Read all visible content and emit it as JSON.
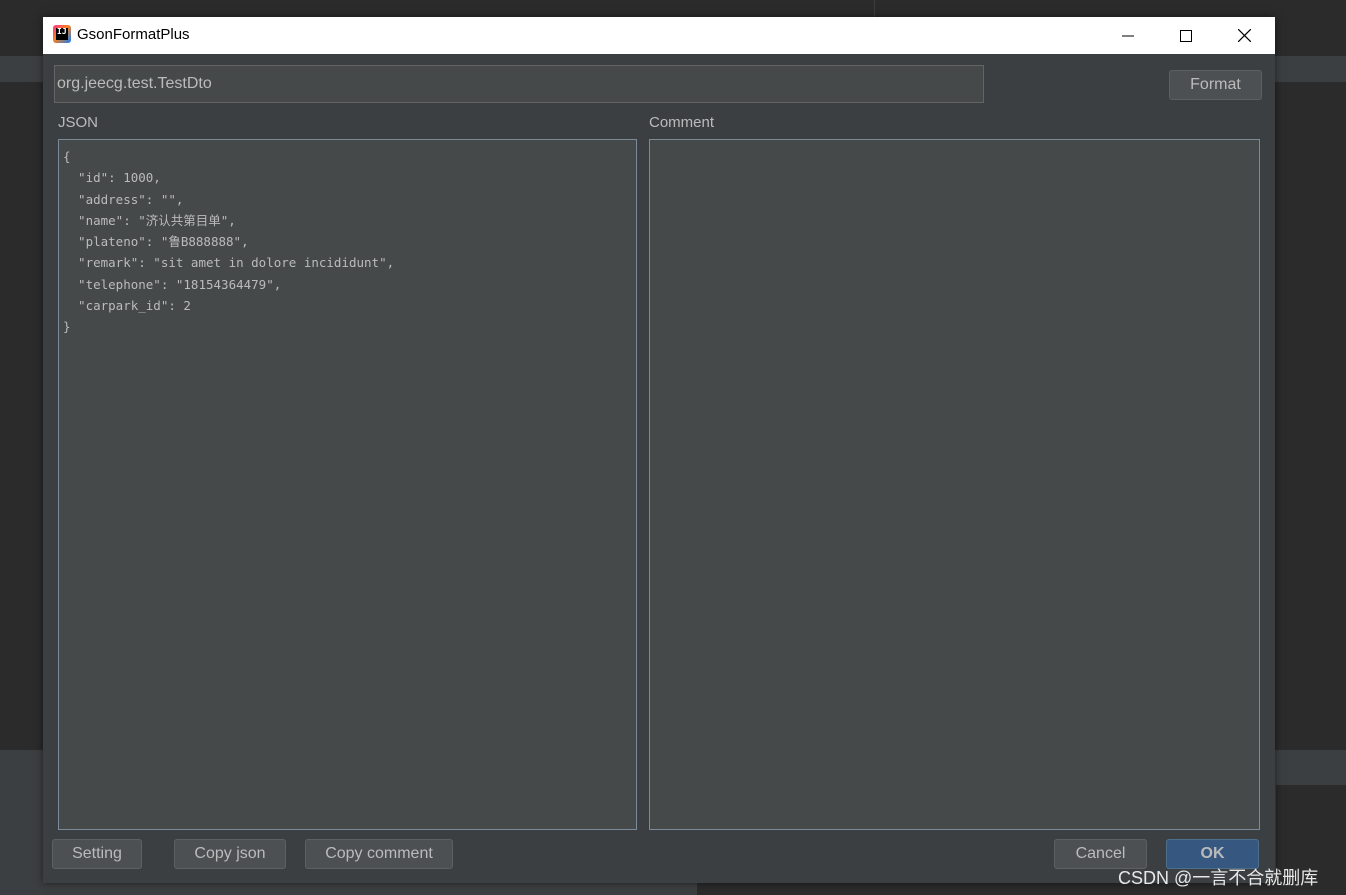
{
  "dialog": {
    "title": "GsonFormatPlus",
    "icon": "intellij-app-icon",
    "icon_mark": "IJ",
    "window_controls": [
      "minimize-icon",
      "maximize-icon",
      "close-icon"
    ]
  },
  "class_input": {
    "value": "org.jeecg.test.TestDto"
  },
  "toolbar": {
    "format_label": "Format"
  },
  "json_pane": {
    "label": "JSON",
    "lines": [
      "{",
      "  \"id\": 1000,",
      "  \"address\": \"\",",
      "  \"name\": \"济认共第目单\",",
      "  \"plateno\": \"鲁B888888\",",
      "  \"remark\": \"sit amet in dolore incididunt\",",
      "  \"telephone\": \"18154364479\",",
      "  \"carpark_id\": 2",
      "}"
    ]
  },
  "comment_pane": {
    "label": "Comment",
    "value": ""
  },
  "footer": {
    "setting_label": "Setting",
    "copy_json_label": "Copy  json",
    "copy_comment_label": "Copy comment",
    "cancel_label": "Cancel",
    "ok_label": "OK"
  },
  "watermark": "CSDN @一言不合就删库",
  "colors": {
    "dialog_bg": "#3c3f41",
    "editor_bg": "#45494a",
    "text": "#bbbbbb",
    "ok_button": "#365880"
  }
}
